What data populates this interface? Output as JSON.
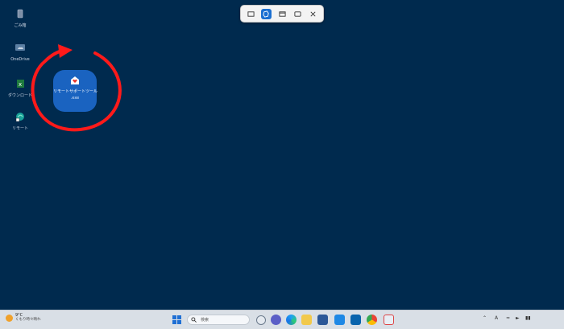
{
  "colors": {
    "desktop_bg": "#002a4e",
    "annotation_red": "#ff1a1a",
    "accent_blue": "#1a6fd1"
  },
  "snip_toolbar": {
    "modes": [
      {
        "name": "rectangle-mode",
        "icon": "rectangle-icon",
        "active": false
      },
      {
        "name": "freeform-mode",
        "icon": "freeform-icon",
        "active": true
      },
      {
        "name": "window-mode",
        "icon": "window-icon",
        "active": false
      },
      {
        "name": "fullscreen-mode",
        "icon": "fullscreen-icon",
        "active": false
      }
    ],
    "close_icon": "close-icon"
  },
  "desktop": {
    "icons": [
      {
        "label": "ごみ箱",
        "icon": "recycle-bin-icon"
      },
      {
        "label": "OneDrive",
        "icon": "onedrive-icon"
      },
      {
        "label": "ダウンロード",
        "icon": "excel-file-icon"
      },
      {
        "label": "リモート",
        "icon": "edge-shortcut-icon"
      }
    ],
    "highlighted_app": {
      "label": "リモートサポートツール",
      "sublabel": ".exe",
      "icon": "remote-support-app-icon"
    }
  },
  "taskbar": {
    "weather": {
      "temp": "9°C",
      "condition": "くもり時々晴れ",
      "icon": "sun-cloud-icon"
    },
    "search_placeholder": "検索",
    "pinned_apps": [
      "copilot-icon",
      "chat-icon",
      "edge-icon",
      "file-explorer-icon",
      "store-icon",
      "mail-icon",
      "outlook-icon",
      "chrome-icon",
      "snipping-tool-icon"
    ],
    "tray": {
      "ime": "A",
      "icons": [
        "chevron-up-icon",
        "wifi-icon",
        "volume-icon",
        "battery-icon"
      ]
    }
  }
}
